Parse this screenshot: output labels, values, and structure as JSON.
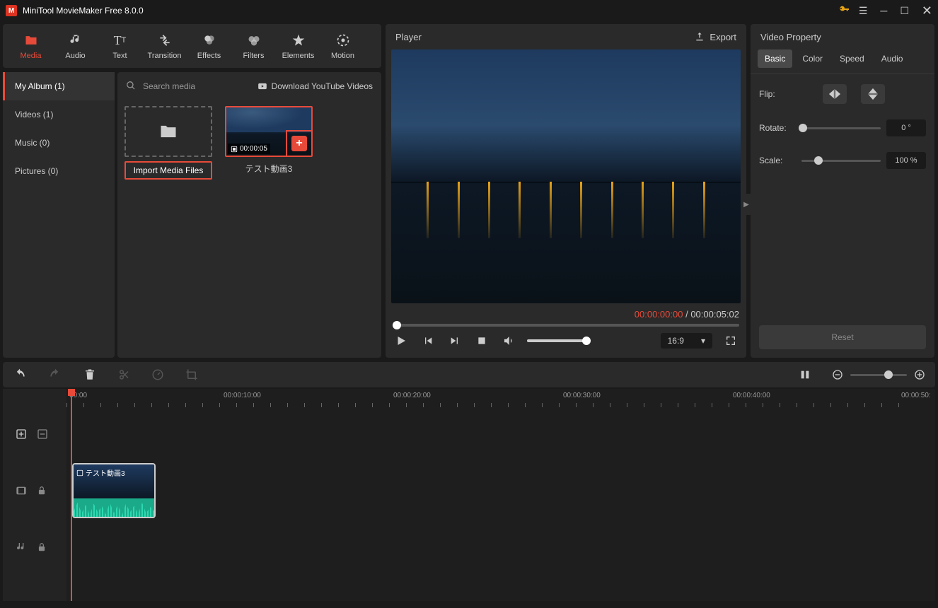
{
  "app": {
    "title": "MiniTool MovieMaker Free 8.0.0"
  },
  "toolbar": {
    "media": "Media",
    "audio": "Audio",
    "text": "Text",
    "transition": "Transition",
    "effects": "Effects",
    "filters": "Filters",
    "elements": "Elements",
    "motion": "Motion"
  },
  "sidebar": {
    "myalbum": "My Album (1)",
    "videos": "Videos (1)",
    "music": "Music (0)",
    "pictures": "Pictures (0)"
  },
  "media": {
    "search_placeholder": "Search media",
    "yt_link": "Download YouTube Videos",
    "import_label": "Import Media Files",
    "clip1": {
      "duration": "00:00:05",
      "name": "テスト動画3"
    }
  },
  "player": {
    "title": "Player",
    "export": "Export",
    "current": "00:00:00:00",
    "sep": " / ",
    "total": "00:00:05:02",
    "aspect": "16:9"
  },
  "props": {
    "title": "Video Property",
    "tabs": {
      "basic": "Basic",
      "color": "Color",
      "speed": "Speed",
      "audio": "Audio"
    },
    "flip": "Flip:",
    "rotate": "Rotate:",
    "rotate_val": "0 °",
    "scale": "Scale:",
    "scale_val": "100 %",
    "reset": "Reset"
  },
  "timeline": {
    "t0": "00:00",
    "t1": "00:00:10:00",
    "t2": "00:00:20:00",
    "t3": "00:00:30:00",
    "t4": "00:00:40:00",
    "t5": "00:00:50:",
    "clip_name": "テスト動画3"
  }
}
